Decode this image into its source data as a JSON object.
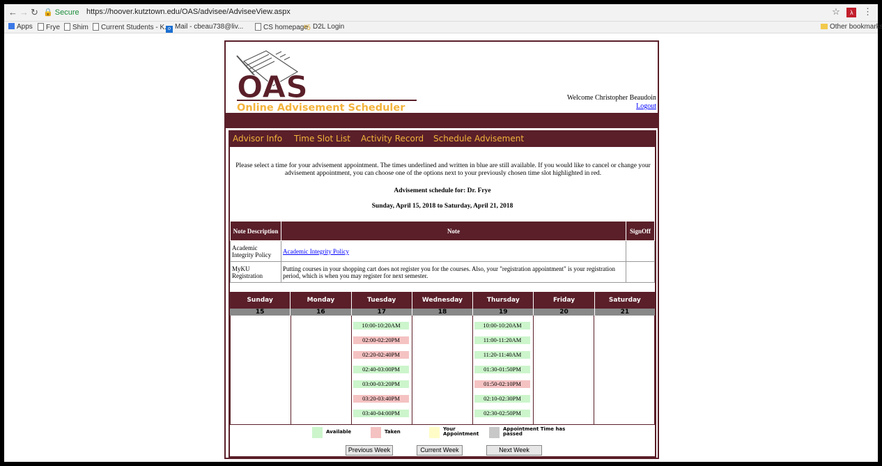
{
  "browser": {
    "secure_label": "Secure",
    "url": "https://hoover.kutztown.edu/OAS/advisee/AdviseeView.aspx",
    "bookmarks": [
      "Apps",
      "Frye",
      "Shim",
      "Current Students - K...",
      "Mail - cbeau738@liv...",
      "CS homepage",
      "D2L Login"
    ],
    "other_bookmarks": "Other bookmarks"
  },
  "header": {
    "logo_big": "OAS",
    "logo_sub": "Online Advisement Scheduler",
    "welcome": "Welcome Christopher Beaudoin",
    "logout": "Logout"
  },
  "menu": [
    "Advisor Info",
    "Time Slot List",
    "Activity Record",
    "Schedule Advisement"
  ],
  "instructions": "Please select a time for your advisement appointment. The times underlined and written in blue are still available. If you would like to cancel or change your advisement appointment, you can choose one of the options next to your previously chosen time slot highlighted in red.",
  "schedule_for": "Advisement schedule for: Dr. Frye",
  "date_range": "Sunday, April 15, 2018 to Saturday, April 21, 2018",
  "notes": {
    "headers": [
      "Note Description",
      "Note",
      "SignOff"
    ],
    "rows": [
      {
        "desc": "Academic Integrity Policy",
        "note": "Academic Integrity Policy"
      },
      {
        "desc": "MyKU Registration",
        "note": "Putting courses in your shopping cart does not register you for the courses. Also, your \"registration appointment\" is your registration period, which is when you may register for next semester."
      }
    ]
  },
  "calendar": {
    "days": [
      "Sunday",
      "Monday",
      "Tuesday",
      "Wednesday",
      "Thursday",
      "Friday",
      "Saturday"
    ],
    "nums": [
      "15",
      "16",
      "17",
      "18",
      "19",
      "20",
      "21"
    ],
    "tuesday": [
      {
        "t": "10:00-10:20AM",
        "s": "avail"
      },
      {
        "t": "02:00-02:20PM",
        "s": "taken"
      },
      {
        "t": "02:20-02:40PM",
        "s": "taken"
      },
      {
        "t": "02:40-03:00PM",
        "s": "avail"
      },
      {
        "t": "03:00-03:20PM",
        "s": "avail"
      },
      {
        "t": "03:20-03:40PM",
        "s": "taken"
      },
      {
        "t": "03:40-04:00PM",
        "s": "avail"
      }
    ],
    "thursday": [
      {
        "t": "10:00-10:20AM",
        "s": "avail"
      },
      {
        "t": "11:00-11:20AM",
        "s": "avail"
      },
      {
        "t": "11:20-11:40AM",
        "s": "avail"
      },
      {
        "t": "01:30-01:50PM",
        "s": "avail"
      },
      {
        "t": "01:50-02:10PM",
        "s": "taken"
      },
      {
        "t": "02:10-02:30PM",
        "s": "avail"
      },
      {
        "t": "02:30-02:50PM",
        "s": "avail"
      }
    ]
  },
  "legend": {
    "available": "Available",
    "taken": "Taken",
    "yours_1": "Your",
    "yours_2": "Appointment",
    "passed_1": "Appointment Time has",
    "passed_2": "passed",
    "colors": {
      "available": "#ccf5cc",
      "taken": "#f5c2c2",
      "yours": "#fffcc8",
      "passed": "#c8c8c8"
    }
  },
  "buttons": {
    "prev": "Previous Week",
    "current": "Current Week",
    "next": "Next Week"
  },
  "colors": {
    "maroon": "#5a1f29",
    "gold": "#f3b43c"
  }
}
